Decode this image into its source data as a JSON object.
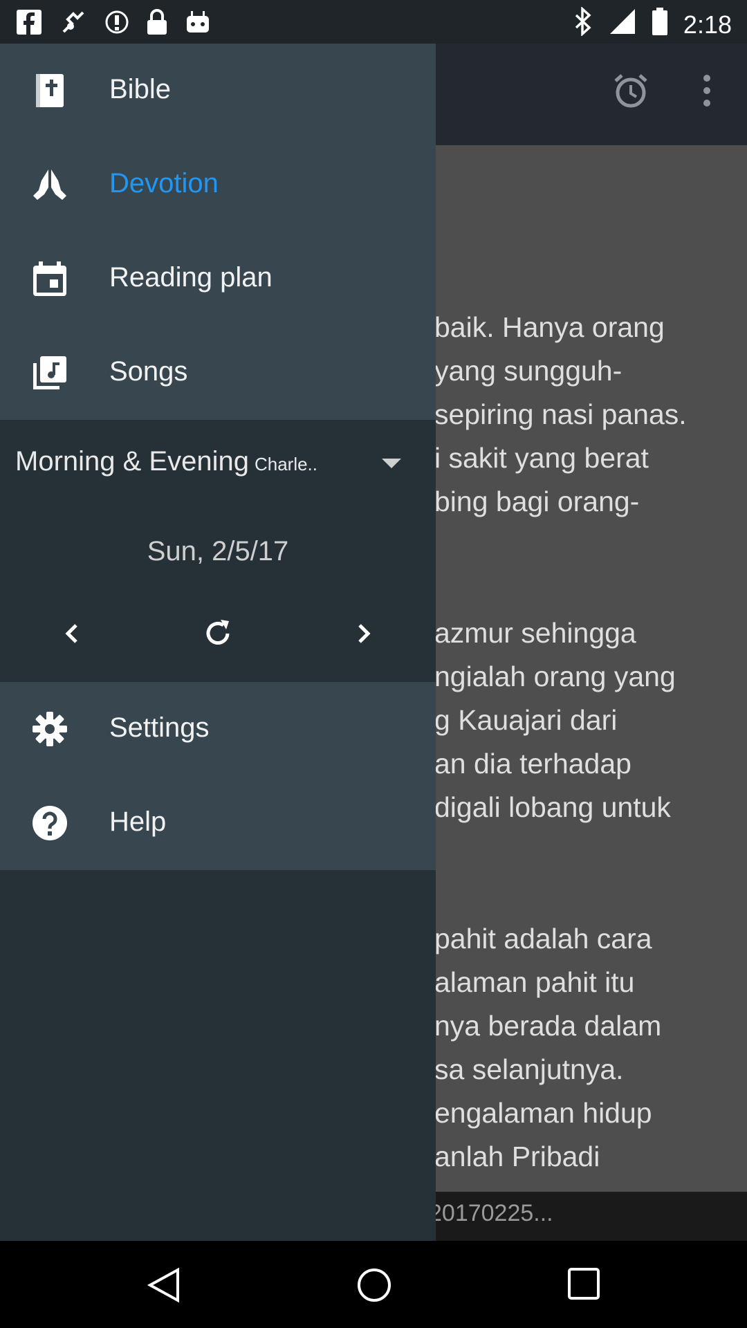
{
  "status_bar": {
    "time": "2:18",
    "left_icons": [
      "facebook-icon",
      "fake-gps-icon",
      "info-icon",
      "lock-icon",
      "android-icon"
    ],
    "right_icons": [
      "bluetooth-icon",
      "signal-icon",
      "battery-icon"
    ]
  },
  "app_bar": {
    "actions": [
      "alarm-icon",
      "more-vert-icon"
    ]
  },
  "drawer": {
    "menu_top": [
      {
        "label": "Bible",
        "icon": "bible-icon"
      },
      {
        "label": "Devotion",
        "icon": "praying-hands-icon",
        "active": true
      },
      {
        "label": "Reading plan",
        "icon": "calendar-icon"
      },
      {
        "label": "Songs",
        "icon": "music-library-icon"
      }
    ],
    "devotion": {
      "title": "Morning & Evening",
      "subtitle": "Charle..",
      "date": "Sun, 2/5/17",
      "controls": [
        "chevron-left-icon",
        "refresh-icon",
        "chevron-right-icon"
      ]
    },
    "menu_bottom": [
      {
        "label": "Settings",
        "icon": "gear-icon"
      },
      {
        "label": "Help",
        "icon": "help-icon"
      }
    ]
  },
  "content": {
    "lines": [
      "baik. Hanya orang",
      "yang sungguh-",
      "sepiring nasi panas.",
      "i sakit yang berat",
      "bing bagi orang-",
      "",
      "",
      "azmur sehingga",
      "ngialah orang yang",
      "g Kauajari dari",
      "an dia terhadap",
      "digali lobang untuk",
      "",
      "",
      "pahit adalah cara",
      "alaman pahit itu",
      "nya berada dalam",
      "sa selanjutnya.",
      "engalaman hidup",
      "anlah Pribadi"
    ],
    "bottom_text": "20170225..."
  },
  "colors": {
    "accent": "#2196f3",
    "drawer_bg": "#263037",
    "menu_bg": "#37464f",
    "app_bar_bg": "#23292e"
  }
}
